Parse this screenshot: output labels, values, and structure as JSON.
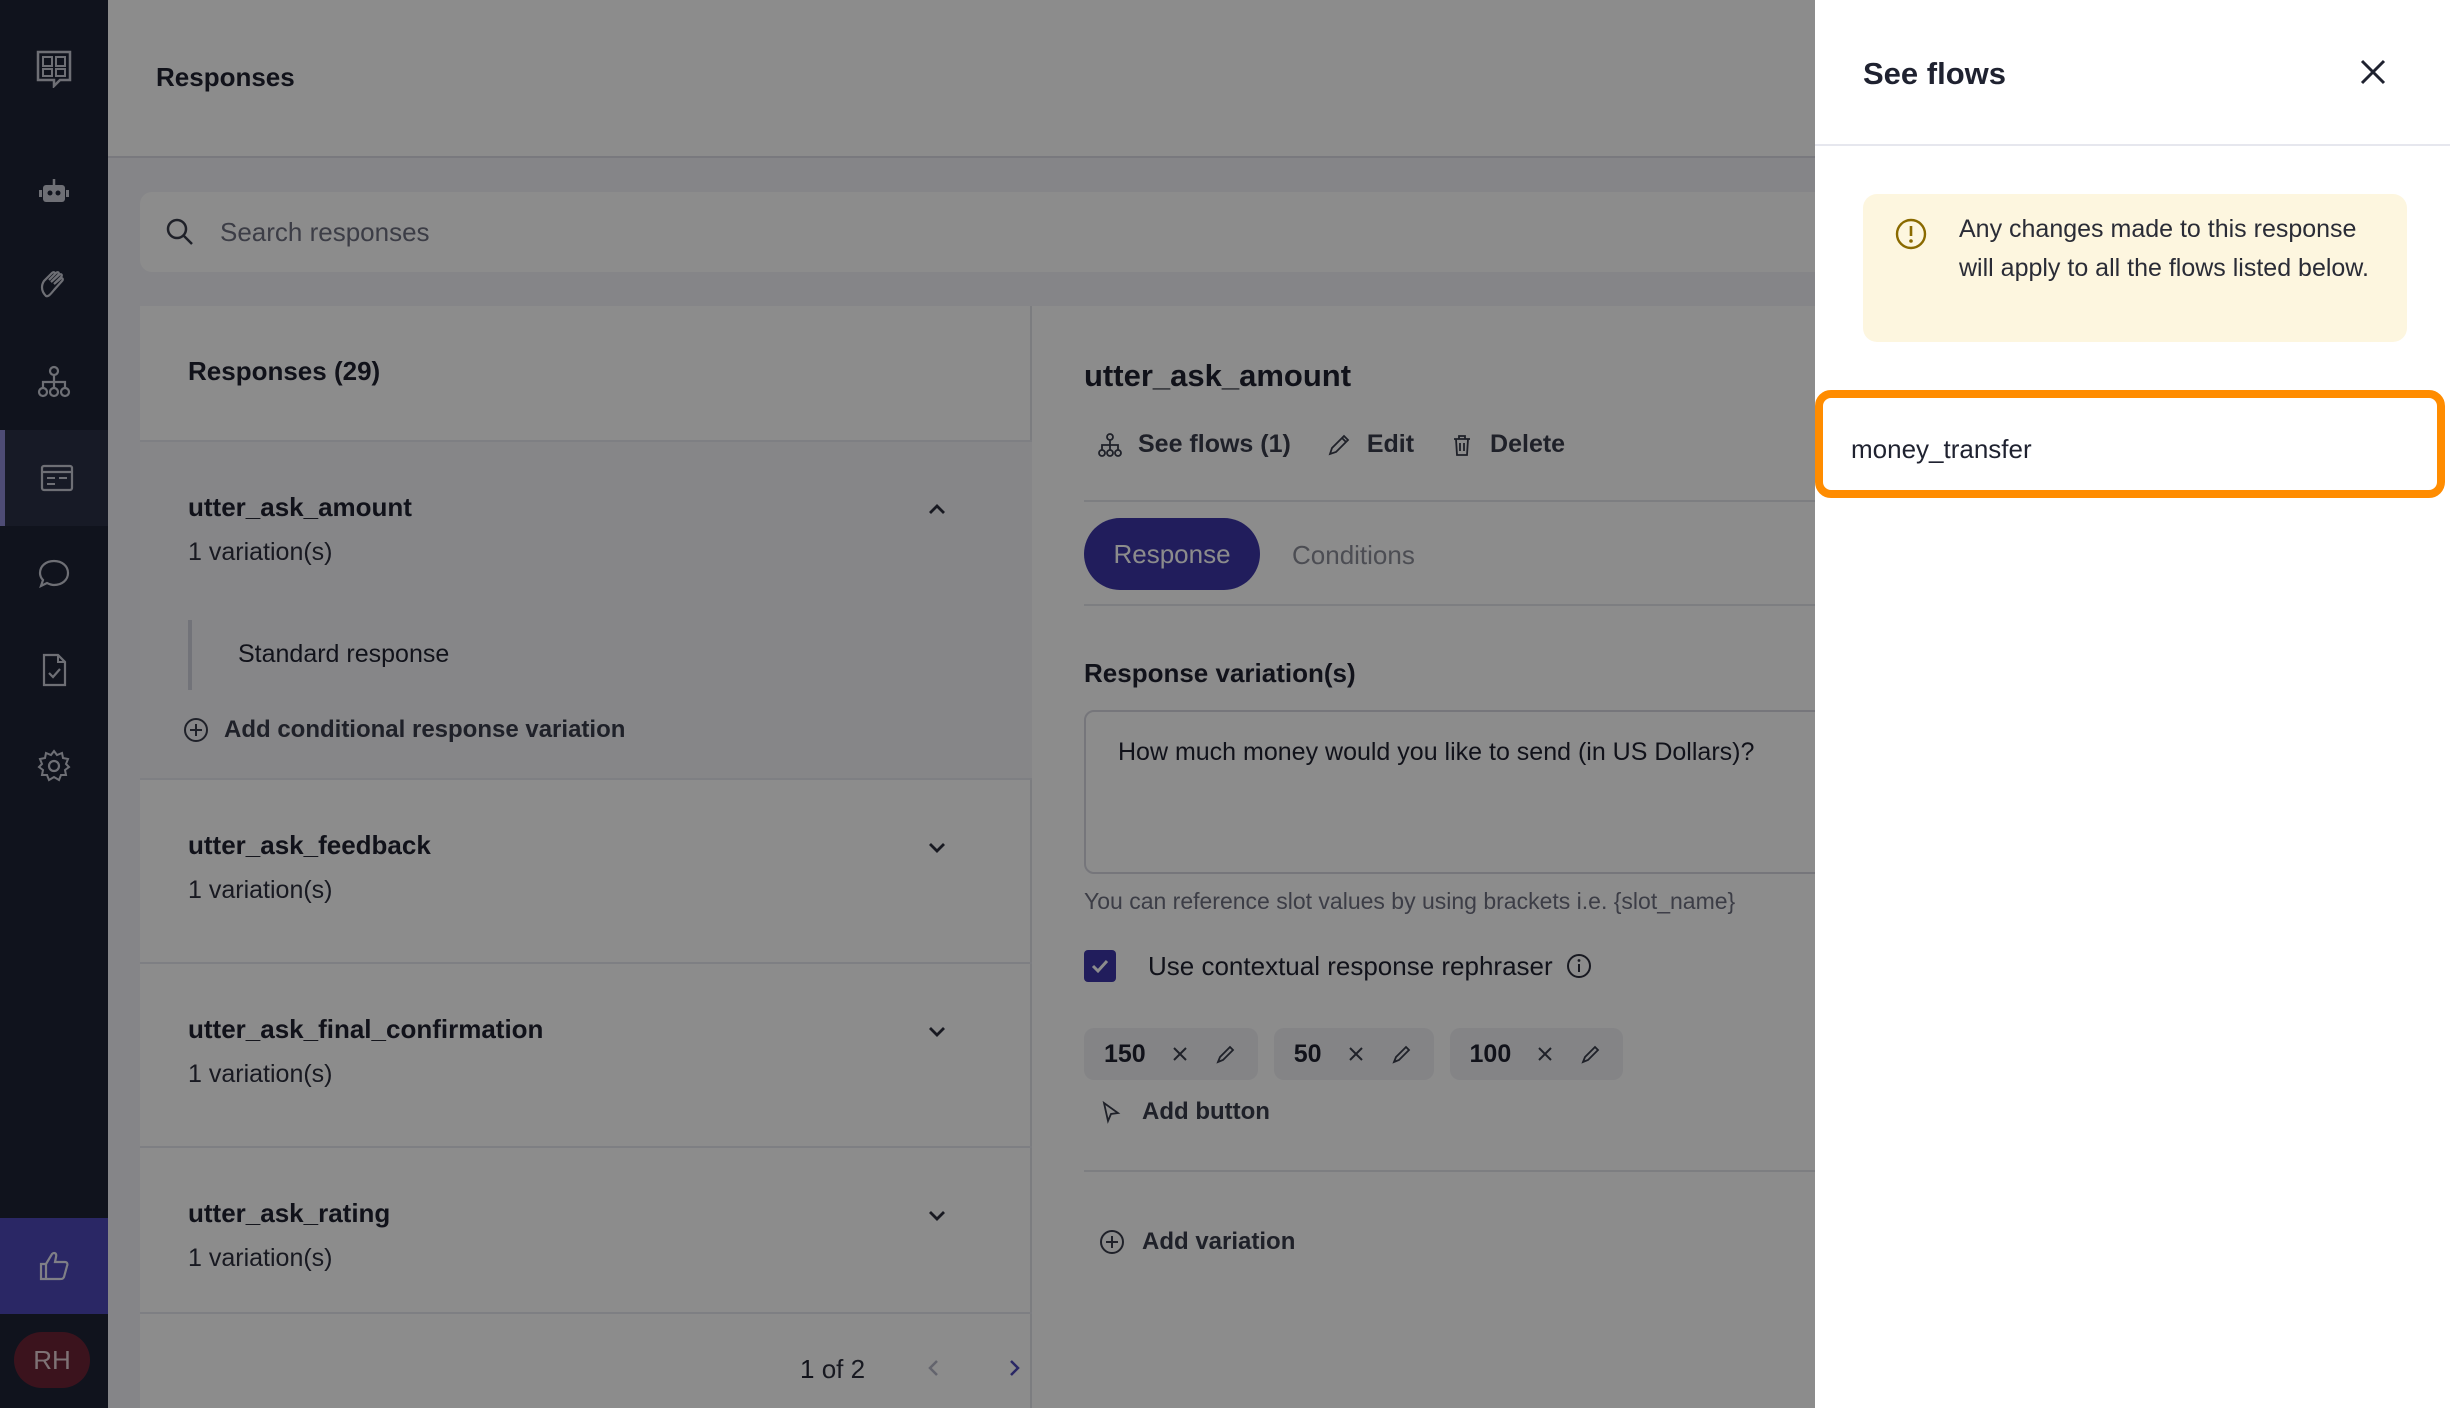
{
  "header": {
    "title": "Responses"
  },
  "search": {
    "placeholder": "Search responses"
  },
  "list": {
    "heading": "Responses (29)",
    "items": [
      {
        "name": "utter_ask_amount",
        "variations": "1 variation(s)",
        "expanded": true,
        "sub": "Standard response",
        "add_conditional": "Add conditional response variation"
      },
      {
        "name": "utter_ask_feedback",
        "variations": "1 variation(s)"
      },
      {
        "name": "utter_ask_final_confirmation",
        "variations": "1 variation(s)"
      },
      {
        "name": "utter_ask_rating",
        "variations": "1 variation(s)"
      }
    ],
    "pagination": {
      "current": "1",
      "of_label": "of 2"
    }
  },
  "detail": {
    "title": "utter_ask_amount",
    "actions": {
      "see_flows": "See flows (1)",
      "edit": "Edit",
      "delete": "Delete"
    },
    "tabs": {
      "response": "Response",
      "conditions": "Conditions"
    },
    "variations_label": "Response variation(s)",
    "variation_text": "How much money would you like to send (in US Dollars)?",
    "hint": "You can reference slot values by using brackets i.e. {slot_name}",
    "rephraser_label": "Use contextual response rephraser",
    "rephraser_checked": true,
    "buttons": [
      "150",
      "50",
      "100"
    ],
    "add_button": "Add button",
    "add_variation": "Add variation"
  },
  "drawer": {
    "title": "See flows",
    "notice": "Any changes made to this response will apply to all the flows listed below.",
    "flows": [
      "money_transfer"
    ]
  },
  "user": {
    "initials": "RH"
  },
  "colors": {
    "accent": "#3c36a8",
    "highlight": "#ff8c00",
    "sidebar": "#1e2436",
    "notice_bg": "#fdf6df"
  }
}
